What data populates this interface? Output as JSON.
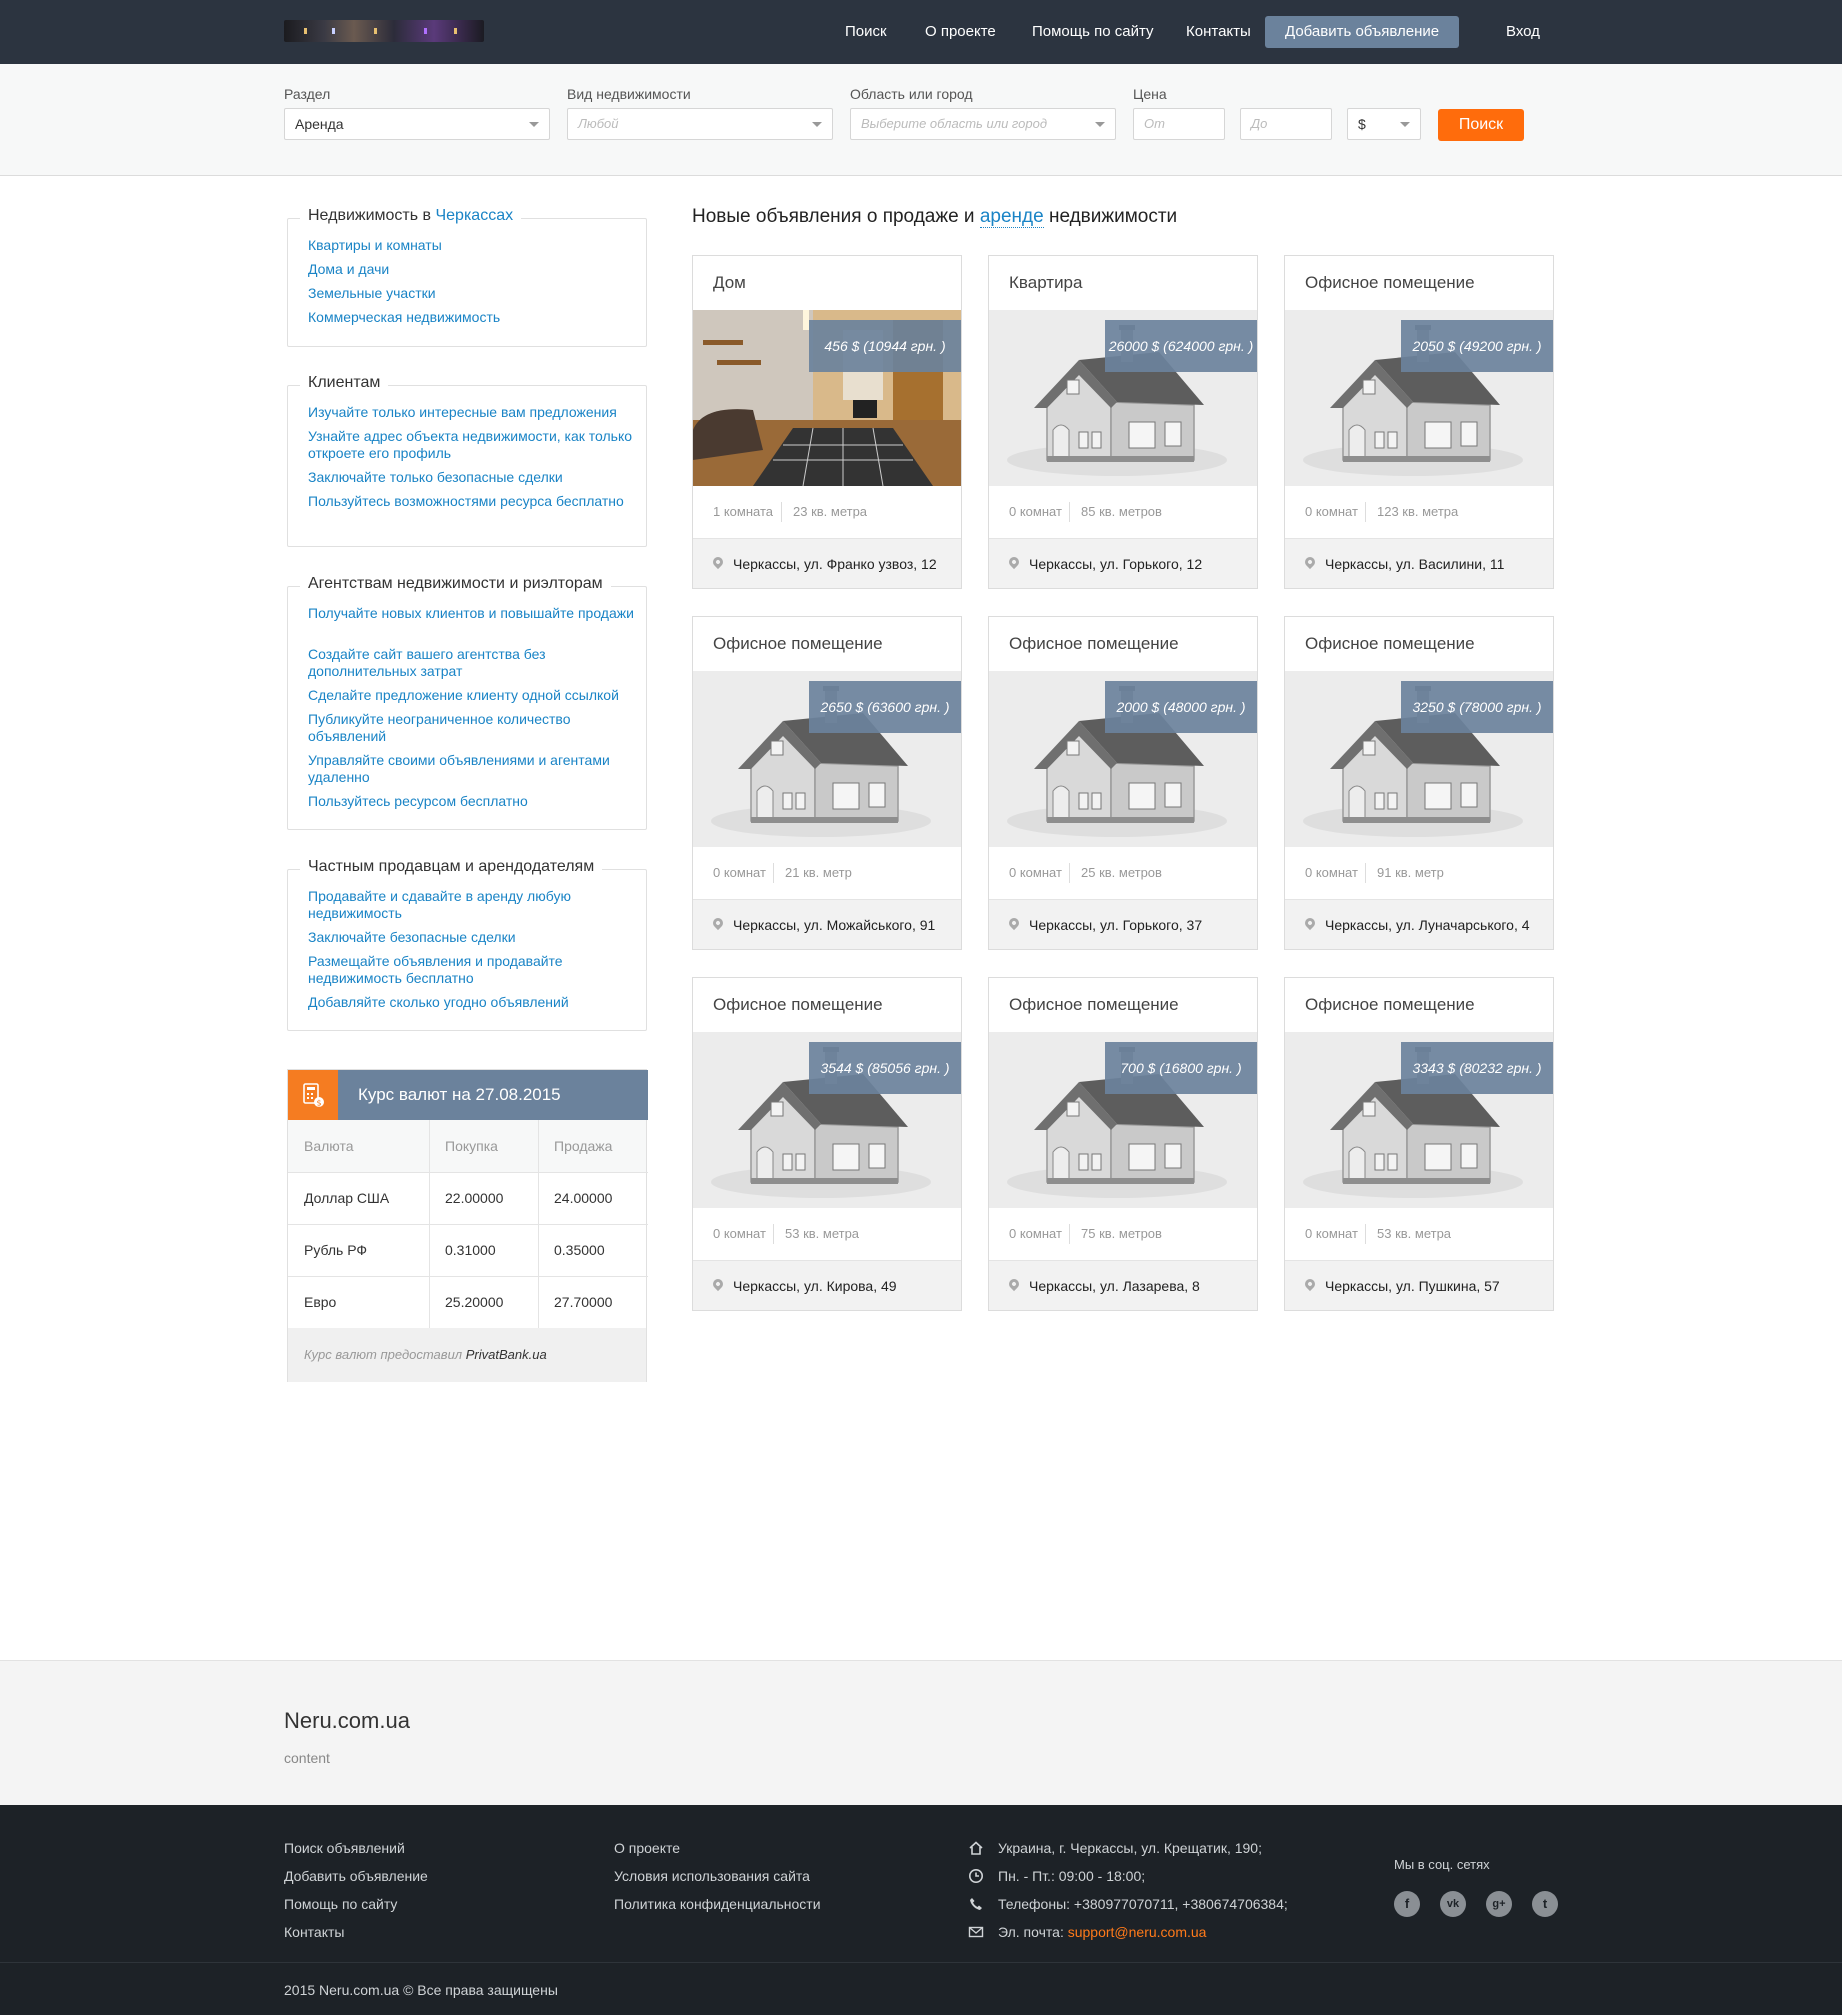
{
  "nav": {
    "search": "Поиск",
    "about": "О проекте",
    "help": "Помощь по сайту",
    "contacts": "Контакты",
    "add": "Добавить объявление",
    "login": "Вход"
  },
  "filters": {
    "section_label": "Раздел",
    "section_value": "Аренда",
    "type_label": "Вид недвижимости",
    "type_placeholder": "Любой",
    "region_label": "Область или город",
    "region_placeholder": "Выберите область или город",
    "price_label": "Цена",
    "price_from_placeholder": "От",
    "price_to_placeholder": "До",
    "currency": "$",
    "submit": "Поиск"
  },
  "sidebar": {
    "realty_title": "Недвижимость в",
    "realty_city": "Черкассах",
    "realty_links": [
      "Квартиры и комнаты",
      "Дома и дачи",
      "Земельные участки",
      "Коммерческая недвижимость"
    ],
    "clients_title": "Клиентам",
    "clients_links": [
      "Изучайте только интересные вам предложения",
      "Узнайте адрес объекта недвижимости, как только откроете его профиль",
      "Заключайте только безопасные сделки",
      "Пользуйтесь возможностями ресурса бесплатно"
    ],
    "agencies_title": "Агентствам недвижимости и риэлторам",
    "agencies_links": [
      "Получайте новых клиентов и повышайте продажи",
      "Создайте сайт вашего агентства без дополнительных затрат",
      "Сделайте предложение клиенту одной ссылкой",
      "Публикуйте неограниченное количество объявлений",
      "Управляйте своими объявлениями и агентами удаленно",
      "Пользуйтесь ресурсом бесплатно"
    ],
    "private_title": "Частным продавцам и арендодателям",
    "private_links": [
      "Продавайте и сдавайте в аренду любую недвижимость",
      "Заключайте безопасные сделки",
      "Размещайте объявления и продавайте недвижимость бесплатно",
      "Добавляйте сколько угодно объявлений"
    ]
  },
  "rates": {
    "title": "Курс валют на 27.08.2015",
    "headers": [
      "Валюта",
      "Покупка",
      "Продажа"
    ],
    "rows": [
      [
        "Доллар США",
        "22.00000",
        "24.00000"
      ],
      [
        "Рубль РФ",
        "0.31000",
        "0.35000"
      ],
      [
        "Евро",
        "25.20000",
        "27.70000"
      ]
    ],
    "footer": "Курс валют предоставил",
    "provider": "PrivatBank.ua"
  },
  "listings_heading": {
    "before": "Новые объявления о продаже и",
    "highlight": "аренде",
    "after": "недвижимости"
  },
  "listings": [
    {
      "title": "Дом",
      "price": "456 $ (10944 грн. )",
      "rooms": "1 комната",
      "area": "23 кв. метра",
      "address": "Черкассы, ул. Франко узвоз, 12",
      "photo": "room-photo"
    },
    {
      "title": "Квартира",
      "price": "26000 $ (624000 грн. )",
      "rooms": "0 комнат",
      "area": "85 кв. метров",
      "address": "Черкассы, ул. Горького, 12",
      "photo": "house-placeholder"
    },
    {
      "title": "Офисное помещение",
      "price": "2050 $ (49200 грн. )",
      "rooms": "0 комнат",
      "area": "123 кв. метра",
      "address": "Черкассы, ул. Василини, 11",
      "photo": "house-placeholder"
    },
    {
      "title": "Офисное помещение",
      "price": "2650 $ (63600 грн. )",
      "rooms": "0 комнат",
      "area": "21 кв. метр",
      "address": "Черкассы, ул. Можайського, 91",
      "photo": "house-placeholder"
    },
    {
      "title": "Офисное помещение",
      "price": "2000 $ (48000 грн. )",
      "rooms": "0 комнат",
      "area": "25 кв. метров",
      "address": "Черкассы, ул. Горького, 37",
      "photo": "house-placeholder"
    },
    {
      "title": "Офисное помещение",
      "price": "3250 $ (78000 грн. )",
      "rooms": "0 комнат",
      "area": "91 кв. метр",
      "address": "Черкассы, ул. Луначарського, 4",
      "photo": "house-placeholder"
    },
    {
      "title": "Офисное помещение",
      "price": "3544 $ (85056 грн. )",
      "rooms": "0 комнат",
      "area": "53 кв. метра",
      "address": "Черкассы, ул. Кирова, 49",
      "photo": "house-placeholder"
    },
    {
      "title": "Офисное помещение",
      "price": "700 $ (16800 грн. )",
      "rooms": "0 комнат",
      "area": "75 кв. метров",
      "address": "Черкассы, ул. Лазарева, 8",
      "photo": "house-placeholder"
    },
    {
      "title": "Офисное помещение",
      "price": "3343 $ (80232 грн. )",
      "rooms": "0 комнат",
      "area": "53 кв. метра",
      "address": "Черкассы, ул. Пушкина, 57",
      "photo": "house-placeholder"
    }
  ],
  "promo": {
    "site": "Neru.com.ua",
    "content": "content"
  },
  "footer": {
    "col1": [
      "Поиск объявлений",
      "Добавить объявление",
      "Помощь по сайту",
      "Контакты"
    ],
    "col2": [
      "О проекте",
      "Условия использования сайта",
      "Политика конфиденциальности"
    ],
    "address": "Украина, г. Черкассы, ул. Крещатик, 190;",
    "hours": "Пн. - Пт.: 09:00 - 18:00;",
    "phones": "Телефоны: +380977070711, +380674706384;",
    "email_label": "Эл. почта:",
    "email": "support@neru.com.ua",
    "social_title": "Мы в соц. сетях",
    "social": [
      "facebook",
      "vkontakte",
      "google-plus",
      "twitter"
    ],
    "social_glyphs": [
      "f",
      "vk",
      "g+",
      "t"
    ],
    "copyright": "2015 Neru.com.ua © Все права защищены"
  },
  "colors": {
    "topbar": "#2c3440",
    "accent": "#6b829c",
    "orange": "#ff6c0c",
    "link": "#1a84c6",
    "footer": "#1d2227"
  }
}
